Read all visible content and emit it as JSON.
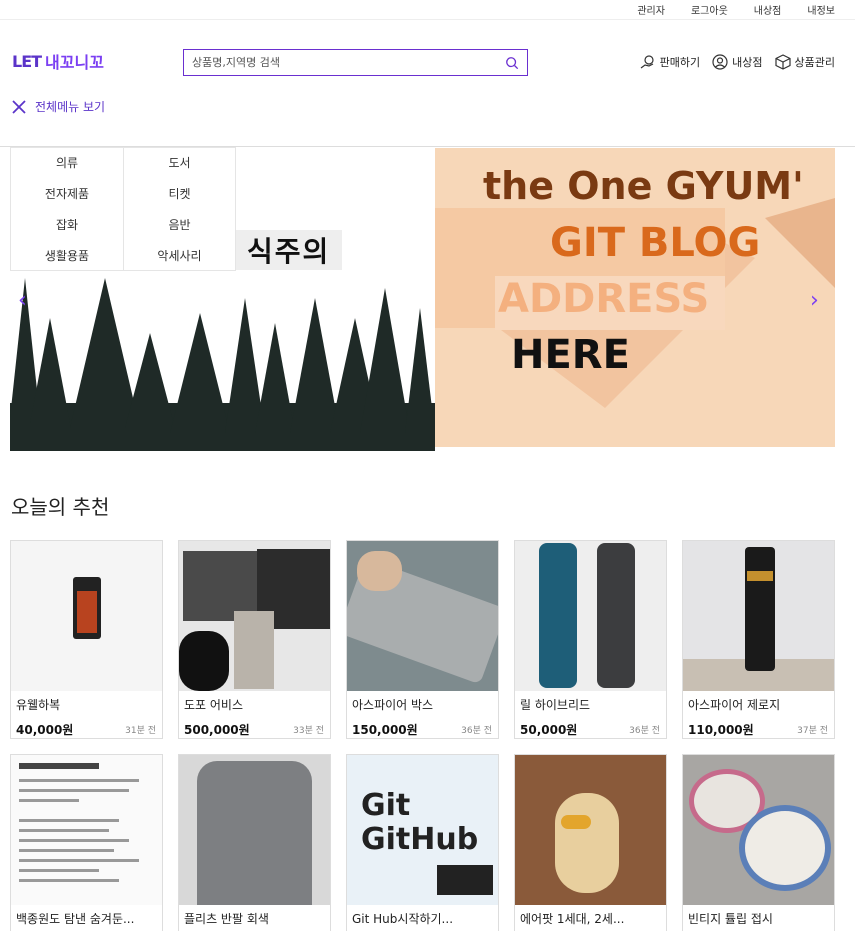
{
  "topbar": {
    "links": [
      "관리자",
      "로그아웃",
      "내상점",
      "내정보"
    ]
  },
  "logo": {
    "mark": "LET",
    "name": "내꼬니꼬"
  },
  "search": {
    "placeholder": "상품명,지역명 검색"
  },
  "header_actions": {
    "sell": "판매하기",
    "my_store": "내상점",
    "manage": "상품관리"
  },
  "menu_toggle": {
    "label": "전체메뉴 보기"
  },
  "categories": {
    "col1": [
      "의류",
      "전자제품",
      "잡화",
      "생활용품"
    ],
    "col2": [
      "도서",
      "티켓",
      "음반",
      "악세사리"
    ]
  },
  "banner": {
    "left_caption": "식주의",
    "right_lines": [
      "the One GYUM'",
      "GIT BLOG",
      "ADDRESS",
      "HERE"
    ]
  },
  "section": {
    "title": "오늘의 추천"
  },
  "products": [
    {
      "title": "유웰하복",
      "price": "40,000원",
      "time": "31분 전"
    },
    {
      "title": "도포 어비스",
      "price": "500,000원",
      "time": "33분 전"
    },
    {
      "title": "아스파이어 박스",
      "price": "150,000원",
      "time": "36분 전"
    },
    {
      "title": "릴 하이브리드",
      "price": "50,000원",
      "time": "36분 전"
    },
    {
      "title": "아스파이어 제로지",
      "price": "110,000원",
      "time": "37분 전"
    },
    {
      "title": "백종원도 탐낸 숨겨둔...",
      "price": "",
      "time": ""
    },
    {
      "title": "플리츠 반팔 회색",
      "price": "",
      "time": ""
    },
    {
      "title": "Git Hub시작하기...",
      "price": "",
      "time": ""
    },
    {
      "title": "에어팟 1세대, 2세...",
      "price": "",
      "time": ""
    },
    {
      "title": "빈티지 튤립 접시",
      "price": "",
      "time": ""
    }
  ],
  "colors": {
    "accent": "#6a2fd0",
    "banner_orange": "#d9691c"
  }
}
